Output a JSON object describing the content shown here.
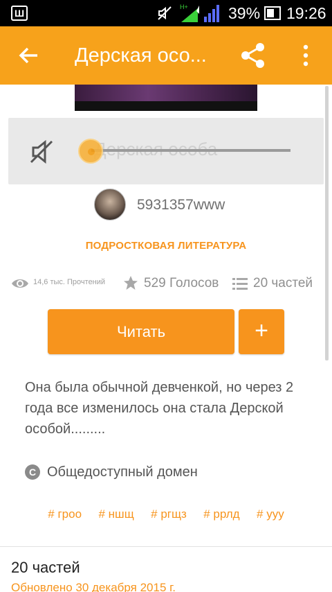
{
  "status_bar": {
    "left_icon": "Ш",
    "signal_type": "H+",
    "battery_percent": "39%",
    "time": "19:26",
    "icons": [
      "mute-icon",
      "signal-icon",
      "battery-icon"
    ]
  },
  "toolbar": {
    "title": "Дерская осо...",
    "icons": [
      "back-arrow-icon",
      "share-icon",
      "more-vert-icon"
    ]
  },
  "player": {
    "title": "Дерская особа",
    "progress": 0.0
  },
  "author": {
    "name": "5931357www"
  },
  "category": "ПОДРОСТКОВАЯ ЛИТЕРАТУРА",
  "stats": {
    "reads": "14,6 тыс. Прочтений",
    "votes": "529 Голосов",
    "parts": "20 частей"
  },
  "actions": {
    "read_label": "Читать",
    "add_label": "+"
  },
  "description": "Она была обычной девченкой, но через 2 года все изменилось она стала Дерской особой.........",
  "license": {
    "icon_glyph": "C",
    "text": "Общедоступный домен"
  },
  "tags": [
    "# гроо",
    "# ншщ",
    "# ргщз",
    "# ррлд",
    "# ууу"
  ],
  "parts_section": {
    "title": "20 частей",
    "updated": "Обновлено 30 декабря 2015 г."
  },
  "colors": {
    "accent": "#f7941d",
    "toolbar": "#f7a21b",
    "statusbar": "#000000"
  }
}
